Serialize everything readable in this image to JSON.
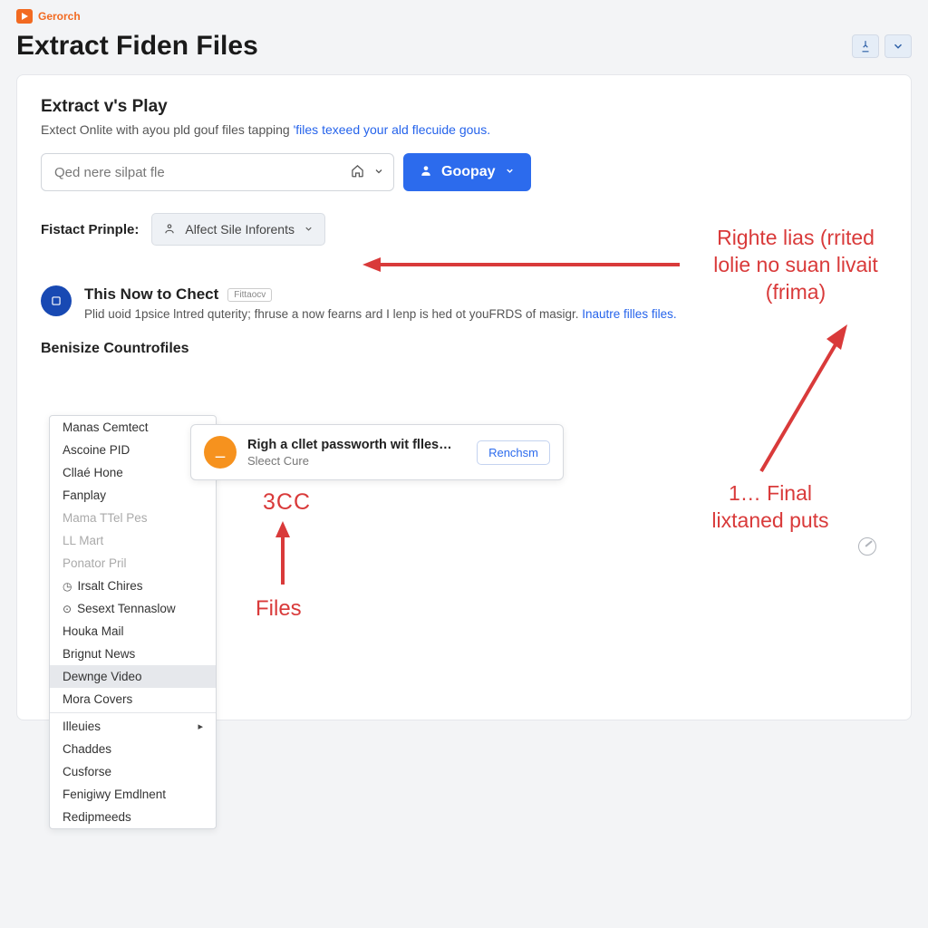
{
  "brand": {
    "label": "Gerorch"
  },
  "page": {
    "title": "Extract Fiden Files"
  },
  "section": {
    "title": "Extract v's Play",
    "subtitle_pre": "Extect Onlite with ayou pld gouf files tapping ",
    "subtitle_link": "'files texeed your ald flecuide gous."
  },
  "search": {
    "placeholder": "Qed nere silpat fle"
  },
  "primary_button": {
    "label": "Goopay"
  },
  "principle": {
    "label": "Fistact Prinple:",
    "value": "Alfect Sile Inforents"
  },
  "info": {
    "title": "This Now to Chect",
    "tag": "Fittaocv",
    "desc_pre": "Plid uoid 1psice lntred quterity; fhruse a now fearns ard I lenp is hed ot youFRDS of masigr. ",
    "desc_link": "Inautre filles files."
  },
  "bensub": {
    "title": "Benisize Countrofiles"
  },
  "dropdown": {
    "items": [
      {
        "label": "Manas Cemtect"
      },
      {
        "label": "Ascoine PID"
      },
      {
        "label": "Cllaé Hone"
      },
      {
        "label": "Fanplay"
      },
      {
        "label": "Mama TTel Pes",
        "faded": true
      },
      {
        "label": "LL Mart",
        "faded": true
      },
      {
        "label": "Ponator Pril",
        "faded": true
      },
      {
        "label": "Irsalt Chires",
        "icon": "clock"
      },
      {
        "label": "Sesext Tennaslow",
        "icon": "target"
      },
      {
        "label": "Houka Mail"
      },
      {
        "label": "Brignut News"
      },
      {
        "label": "Dewnge Video",
        "selected": true
      },
      {
        "label": "Mora Covers"
      },
      {
        "label": "Illeuies",
        "arrow": true,
        "sep_before": true
      },
      {
        "label": "Chaddes"
      },
      {
        "label": "Cusforse"
      },
      {
        "label": "Fenigiwy Emdlnent"
      },
      {
        "label": "Redipmeeds"
      }
    ]
  },
  "popup": {
    "title": "Righ a cllet passworth wit flles…",
    "sub": "Sleect Cure",
    "button": "Renchsm"
  },
  "annotations": {
    "righte": "Righte lias (rrited\nlolie no suan livait\n(frima)",
    "final": "1… Final\nlixtaned puts",
    "cc": "3CC",
    "files": "Files"
  }
}
